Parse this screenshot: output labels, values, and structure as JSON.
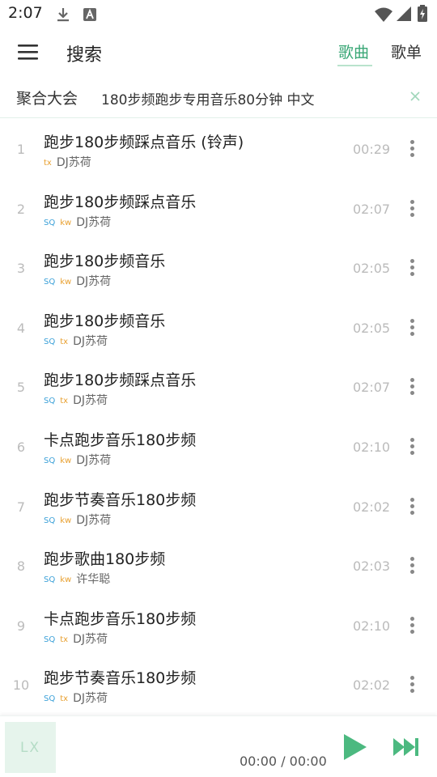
{
  "status_bar": {
    "time": "2:07"
  },
  "header": {
    "menu_icon": "hamburger-menu-icon",
    "title": "搜索",
    "tabs": [
      {
        "label": "歌曲",
        "active": true
      },
      {
        "label": "歌单",
        "active": false
      }
    ]
  },
  "search": {
    "source": "聚合大会",
    "query": "180步频跑步专用音乐80分钟 中文",
    "clear_icon": "close-icon"
  },
  "songs": [
    {
      "num": "1",
      "title": "跑步180步频踩点音乐 (铃声)",
      "badges": [
        "tx"
      ],
      "artist": "DJ苏荷",
      "duration": "00:29"
    },
    {
      "num": "2",
      "title": "跑步180步频踩点音乐",
      "badges": [
        "SQ",
        "kw"
      ],
      "artist": "DJ苏荷",
      "duration": "02:07"
    },
    {
      "num": "3",
      "title": "跑步180步频音乐",
      "badges": [
        "SQ",
        "kw"
      ],
      "artist": "DJ苏荷",
      "duration": "02:05"
    },
    {
      "num": "4",
      "title": "跑步180步频音乐",
      "badges": [
        "SQ",
        "tx"
      ],
      "artist": "DJ苏荷",
      "duration": "02:05"
    },
    {
      "num": "5",
      "title": "跑步180步频踩点音乐",
      "badges": [
        "SQ",
        "tx"
      ],
      "artist": "DJ苏荷",
      "duration": "02:07"
    },
    {
      "num": "6",
      "title": "卡点跑步音乐180步频",
      "badges": [
        "SQ",
        "kw"
      ],
      "artist": "DJ苏荷",
      "duration": "02:10"
    },
    {
      "num": "7",
      "title": "跑步节奏音乐180步频",
      "badges": [
        "SQ",
        "kw"
      ],
      "artist": "DJ苏荷",
      "duration": "02:02"
    },
    {
      "num": "8",
      "title": "跑步歌曲180步频",
      "badges": [
        "SQ",
        "kw"
      ],
      "artist": "许华聪",
      "duration": "02:03"
    },
    {
      "num": "9",
      "title": "卡点跑步音乐180步频",
      "badges": [
        "SQ",
        "tx"
      ],
      "artist": "DJ苏荷",
      "duration": "02:10"
    },
    {
      "num": "10",
      "title": "跑步节奏音乐180步频",
      "badges": [
        "SQ",
        "tx"
      ],
      "artist": "DJ苏荷",
      "duration": "02:02"
    }
  ],
  "player": {
    "logo": "LX",
    "time": "00:00 / 00:00",
    "play_icon": "play-icon",
    "next_icon": "skip-next-icon"
  },
  "colors": {
    "accent": "#3aa776",
    "badge_sq": "#3aa0d8",
    "badge_source": "#e8a030"
  }
}
